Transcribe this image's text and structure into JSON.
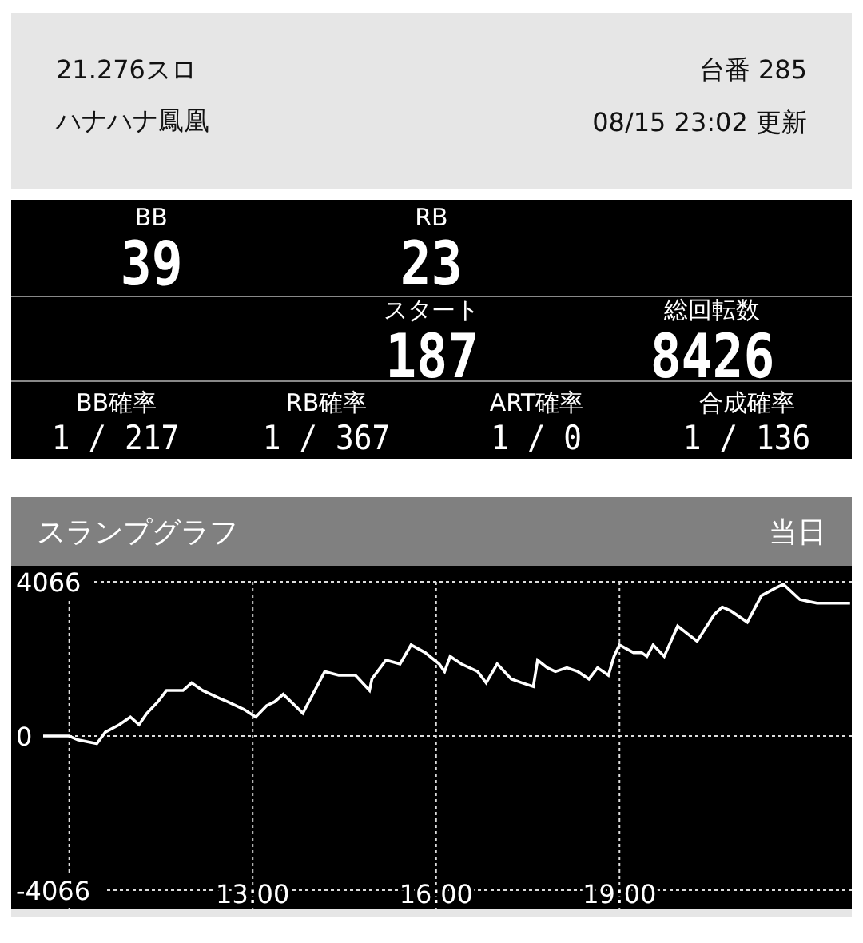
{
  "header": {
    "rate": "21.276スロ",
    "machine_number": "台番 285",
    "machine_name": "ハナハナ鳳凰",
    "updated": "08/15 23:02 更新"
  },
  "counters": [
    [
      {
        "label": "BB",
        "value": "39"
      },
      {
        "label": "RB",
        "value": "23"
      }
    ],
    [
      {
        "label": "スタート",
        "value": "187"
      },
      {
        "label": "総回転数",
        "value": "8426"
      }
    ]
  ],
  "probabilities": [
    {
      "label": "BB確率",
      "value": "1 / 217"
    },
    {
      "label": "RB確率",
      "value": "1 / 367"
    },
    {
      "label": "ART確率",
      "value": "1 / 0"
    },
    {
      "label": "合成確率",
      "value": "1 / 136"
    }
  ],
  "slump_graph": {
    "title": "スランプグラフ",
    "period": "当日",
    "chart_data": {
      "type": "line",
      "xlim": [
        9.05,
        22.8
      ],
      "ylim": [
        -4571,
        4487
      ],
      "grid": true,
      "xticks": [
        {
          "value": 13,
          "label": "13:00"
        },
        {
          "value": 16,
          "label": "16:00"
        },
        {
          "value": 19,
          "label": "19:00"
        }
      ],
      "yticks": [
        -4066,
        0,
        4066
      ],
      "x": [
        9.05,
        10,
        10.14,
        10.45,
        10.59,
        10.82,
        11,
        11.14,
        11.27,
        11.45,
        11.59,
        11.86,
        12,
        12.18,
        12.45,
        12.59,
        12.86,
        13.05,
        13.23,
        13.36,
        13.5,
        13.82,
        14.18,
        14.41,
        14.68,
        14.91,
        14.95,
        15.18,
        15.41,
        15.59,
        15.82,
        16.05,
        16.14,
        16.23,
        16.41,
        16.68,
        16.82,
        17,
        17.23,
        17.41,
        17.59,
        17.66,
        17.82,
        17.95,
        18.14,
        18.32,
        18.5,
        18.64,
        18.82,
        18.91,
        19,
        19.23,
        19.36,
        19.45,
        19.55,
        19.73,
        19.95,
        20.27,
        20.55,
        20.68,
        20.82,
        21.09,
        21.32,
        21.55,
        21.68,
        21.95,
        22.23,
        22.77
      ],
      "series": [
        {
          "color": "#ffffff",
          "values": [
            0,
            0,
            -100,
            -200,
            100,
            300,
            500,
            300,
            600,
            900,
            1200,
            1200,
            1400,
            1200,
            1000,
            900,
            700,
            500,
            800,
            900,
            1100,
            600,
            1700,
            1600,
            1600,
            1200,
            1500,
            2000,
            1900,
            2400,
            2200,
            1900,
            1700,
            2100,
            1900,
            1700,
            1400,
            1900,
            1500,
            1400,
            1300,
            2000,
            1800,
            1700,
            1800,
            1700,
            1500,
            1800,
            1600,
            2100,
            2400,
            2200,
            2200,
            2100,
            2400,
            2100,
            2900,
            2500,
            3200,
            3400,
            3300,
            3000,
            3700,
            3900,
            4000,
            3600,
            3500,
            3500
          ]
        }
      ]
    }
  }
}
